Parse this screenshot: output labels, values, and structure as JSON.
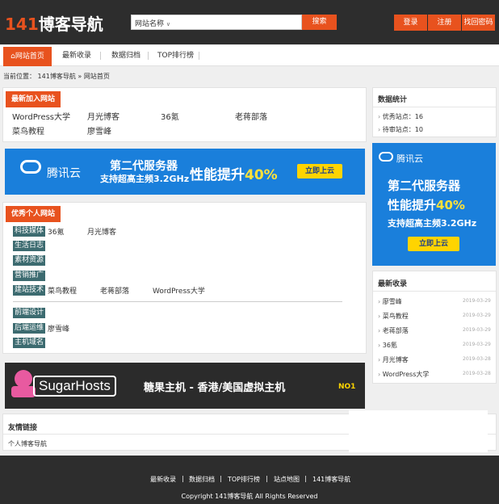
{
  "header": {
    "logo_num": "141",
    "logo_text": "博客导航",
    "search_select": "网站名称",
    "search_button": "搜索",
    "login": "登录",
    "register": "注册",
    "forgot": "找回密码"
  },
  "nav": {
    "items": [
      "网站首页",
      "最新收录",
      "数据归档",
      "TOP排行榜"
    ]
  },
  "breadcrumb": {
    "prefix": "当前位置：",
    "site": "141博客导航",
    "sep": "»",
    "current": "网站首页"
  },
  "newest": {
    "tag": "最新加入网站",
    "sites": [
      "WordPress大学",
      "月光博客",
      "36氪",
      "老蒋部落",
      "菜鸟教程",
      "廖雪峰"
    ]
  },
  "ad_tencent": {
    "brand": "腾讯云",
    "line1": "第二代服务器",
    "line2": "支持超高主频3.2GHz",
    "perf_prefix": "性能提升",
    "perf_value": "40%",
    "button": "立即上云"
  },
  "personal": {
    "tag": "优秀个人网站",
    "categories": [
      {
        "label": "科技媒体",
        "sites": [
          "36氪",
          "月光博客"
        ]
      },
      {
        "label": "生活日志",
        "sites": []
      },
      {
        "label": "素材资源",
        "sites": []
      },
      {
        "label": "营销推广",
        "sites": []
      },
      {
        "label": "建站技术",
        "sites": [
          "菜鸟教程",
          "老蒋部落",
          "WordPress大学"
        ]
      },
      {
        "label": "前端设计",
        "sites": []
      },
      {
        "label": "后端运维",
        "sites": [
          "廖雪峰"
        ]
      },
      {
        "label": "主机域名",
        "sites": []
      }
    ]
  },
  "ad_sugar": {
    "brand": "SugarHosts",
    "slogan": "糖果主机 - 香港/美国虚拟主机",
    "badge": "NO1"
  },
  "stats": {
    "title": "数据统计",
    "items": [
      "优秀站点：16",
      "待审站点：10"
    ]
  },
  "recent": {
    "title": "最新收录",
    "items": [
      {
        "name": "廖雪峰",
        "date": "2019-03-29"
      },
      {
        "name": "菜鸟教程",
        "date": "2019-03-29"
      },
      {
        "name": "老蒋部落",
        "date": "2019-03-29"
      },
      {
        "name": "36氪",
        "date": "2019-03-29"
      },
      {
        "name": "月光博客",
        "date": "2019-03-28"
      },
      {
        "name": "WordPress大学",
        "date": "2019-03-28"
      }
    ]
  },
  "friends": {
    "title": "友情链接",
    "items": [
      "个人博客导航"
    ]
  },
  "footer": {
    "links": [
      "最新收录",
      "数据归档",
      "TOP排行榜",
      "站点地图",
      "141博客导航"
    ],
    "sep": "|",
    "copyright": "Copyright 141博客导航 All Rights Reserved"
  },
  "colors": {
    "accent": "#e8521e",
    "dark": "#2d2d2d",
    "category": "#3c6b70",
    "tencent_blue": "#1a7fdb"
  }
}
